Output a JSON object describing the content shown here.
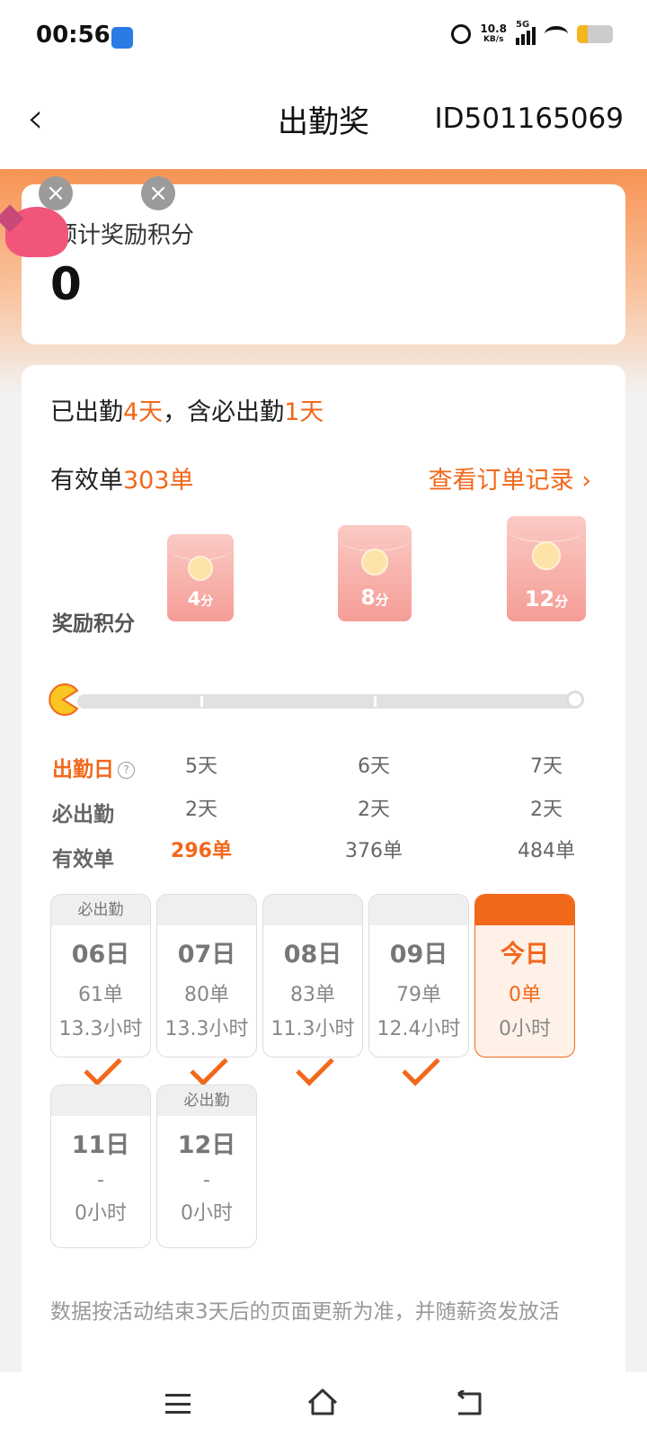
{
  "status_bar": {
    "time": "00:56",
    "net_speed_value": "10.8",
    "net_speed_unit": "KB/s",
    "network_type": "5G",
    "battery_level": 0.3,
    "icons": [
      "app-icon",
      "alarm-icon",
      "signal-icon",
      "wifi-icon",
      "battery-icon"
    ]
  },
  "header": {
    "back_icon": "back-arrow-icon",
    "title": "出勤奖",
    "user_id": "ID501165069"
  },
  "summary": {
    "label": "预计奖励积分",
    "value": "0"
  },
  "attendance": {
    "line1_prefix": "已出勤",
    "line1_days": "4天",
    "line1_mid": "，含必出勤",
    "line1_required": "1天",
    "valid_prefix": "有效单",
    "valid_count": "303单",
    "orders_link": "查看订单记录",
    "orders_link_icon": "chevron-right-icon"
  },
  "rewards": {
    "label": "奖励积分",
    "tiers": [
      {
        "points": "4",
        "unit": "分"
      },
      {
        "points": "8",
        "unit": "分"
      },
      {
        "points": "12",
        "unit": "分"
      }
    ]
  },
  "progress": {
    "value": 0.0
  },
  "requirements": {
    "row_labels": {
      "attendance_days": "出勤日",
      "required_days": "必出勤",
      "valid_orders": "有效单"
    },
    "help_icon": "question-icon",
    "columns": [
      {
        "attendance_days": "5天",
        "required_days": "2天",
        "valid_orders": "296单"
      },
      {
        "attendance_days": "6天",
        "required_days": "2天",
        "valid_orders": "376单"
      },
      {
        "attendance_days": "7天",
        "required_days": "2天",
        "valid_orders": "484单"
      }
    ]
  },
  "days": [
    {
      "tag": "必出勤",
      "date": "06日",
      "orders": "61单",
      "hours": "13.3小时",
      "checked": true
    },
    {
      "tag": "",
      "date": "07日",
      "orders": "80单",
      "hours": "13.3小时",
      "checked": true
    },
    {
      "tag": "",
      "date": "08日",
      "orders": "83单",
      "hours": "11.3小时",
      "checked": true
    },
    {
      "tag": "",
      "date": "09日",
      "orders": "79单",
      "hours": "12.4小时",
      "checked": true
    },
    {
      "tag": "",
      "date": "今日",
      "orders": "0单",
      "hours": "0小时",
      "checked": false
    },
    {
      "tag": "",
      "date": "11日",
      "orders": "-",
      "hours": "0小时",
      "checked": false
    },
    {
      "tag": "必出勤",
      "date": "12日",
      "orders": "-",
      "hours": "0小时",
      "checked": false
    }
  ],
  "footnote": "数据按活动结束3天后的页面更新为准，并随薪资发放活",
  "overlay": {
    "close_label": "×"
  },
  "nav": {
    "icons": [
      "menu-icon",
      "home-icon",
      "back-icon"
    ]
  },
  "colors": {
    "accent": "#f2681b",
    "banner": "#f79454"
  }
}
